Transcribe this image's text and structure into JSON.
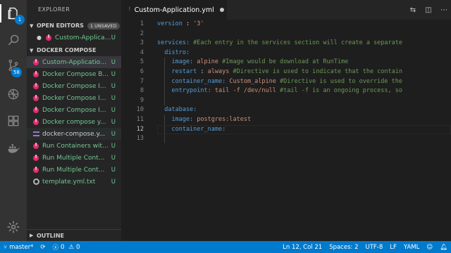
{
  "sidebar": {
    "title": "EXPLORER",
    "open_editors": {
      "label": "OPEN EDITORS",
      "badge": "1 UNSAVED",
      "items": [
        {
          "name": "Custom-Applicati...",
          "status": "U"
        }
      ]
    },
    "project": {
      "label": "DOCKER COMPOSE",
      "files": [
        {
          "name": "Custom-Application.yml",
          "status": "U",
          "icon": "bang"
        },
        {
          "name": "Docker Compose B...",
          "status": "U",
          "icon": "bang"
        },
        {
          "name": "Docker Compose I...",
          "status": "U",
          "icon": "bang"
        },
        {
          "name": "Docker Compose I...",
          "status": "U",
          "icon": "bang"
        },
        {
          "name": "Docker Compose I...",
          "status": "U",
          "icon": "bang"
        },
        {
          "name": "Docker compose y...",
          "status": "U",
          "icon": "bang"
        },
        {
          "name": "docker-compose.y...",
          "status": "U",
          "icon": "eq"
        },
        {
          "name": "Run Containers wit...",
          "status": "U",
          "icon": "bang"
        },
        {
          "name": "Run Multiple Cont...",
          "status": "U",
          "icon": "bang"
        },
        {
          "name": "Run Multiple Cont...",
          "status": "U",
          "icon": "bang"
        },
        {
          "name": "template.yml.txt",
          "status": "U",
          "icon": "txt"
        }
      ]
    },
    "outline_label": "OUTLINE"
  },
  "activity": {
    "scm_badge": "58",
    "explorer_badge": "1"
  },
  "tab": {
    "title": "Custom-Application.yml"
  },
  "editor": {
    "line_numbers": [
      "1",
      "2",
      "3",
      "4",
      "5",
      "6",
      "7",
      "8",
      "9",
      "10",
      "11",
      "12",
      "13"
    ],
    "current_line": 12,
    "lines": [
      [
        {
          "t": "version",
          "c": "k"
        },
        {
          "t": " : ",
          "c": "p"
        },
        {
          "t": "'3'",
          "c": "s"
        }
      ],
      [],
      [
        {
          "t": "services:",
          "c": "k"
        },
        {
          "t": " #Each entry in the services section will create a separate",
          "c": "c"
        }
      ],
      [
        {
          "t": "  distro:",
          "c": "k"
        }
      ],
      [
        {
          "t": "    image:",
          "c": "k"
        },
        {
          "t": " alpine",
          "c": "s"
        },
        {
          "t": " #Image would be download at RunTime",
          "c": "c"
        }
      ],
      [
        {
          "t": "    restart",
          "c": "k"
        },
        {
          "t": " : ",
          "c": "p"
        },
        {
          "t": "always",
          "c": "s"
        },
        {
          "t": " #Directive is used to indicate that the contain",
          "c": "c"
        }
      ],
      [
        {
          "t": "    container_name:",
          "c": "k"
        },
        {
          "t": " Custom_alpine",
          "c": "s"
        },
        {
          "t": " #Directive is used to override the",
          "c": "c"
        }
      ],
      [
        {
          "t": "    entrypoint:",
          "c": "k"
        },
        {
          "t": " tail -f /dev/null",
          "c": "s"
        },
        {
          "t": " #tail -f is an ongoing process, so",
          "c": "c"
        }
      ],
      [],
      [
        {
          "t": "  database:",
          "c": "k"
        }
      ],
      [
        {
          "t": "    image:",
          "c": "k"
        },
        {
          "t": " postgres:latest",
          "c": "s"
        }
      ],
      [
        {
          "t": "    container_name:",
          "c": "k"
        }
      ],
      []
    ]
  },
  "status": {
    "branch": "master*",
    "errors": "0",
    "warnings": "0",
    "cursor": "Ln 12, Col 21",
    "spaces": "Spaces: 2",
    "encoding": "UTF-8",
    "eol": "LF",
    "language": "YAML"
  },
  "colors": {
    "status_bar": "#007acc",
    "untracked": "#73c991"
  }
}
